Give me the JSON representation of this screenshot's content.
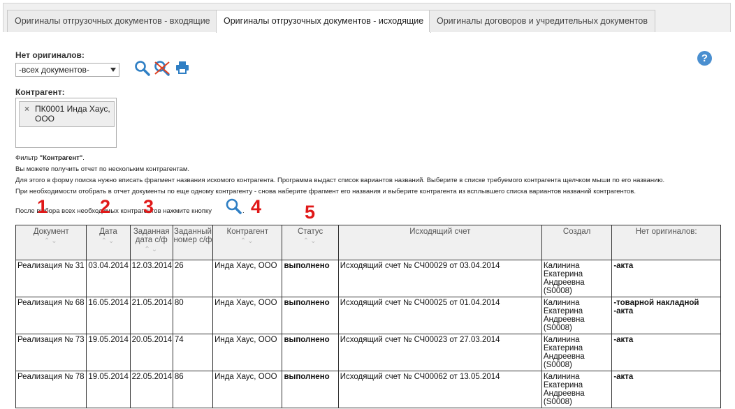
{
  "tabs": [
    {
      "label": "Оригиналы отгрузочных документов - входящие",
      "active": false
    },
    {
      "label": "Оригиналы отгрузочных документов - исходящие",
      "active": true
    },
    {
      "label": "Оригиналы договоров и учредительных документов",
      "active": false
    }
  ],
  "filter": {
    "no_originals_label": "Нет оригиналов:",
    "select_value": "-всех документов-",
    "counterparty_label": "Контрагент:",
    "chip": "ПК0001 Инда Хаус, ООО"
  },
  "help": "?",
  "notes": {
    "line1_prefix": "Фильтр ",
    "line1_bold": "\"Контрагент\"",
    "line1_suffix": ".",
    "line2": "Вы можете получить отчет по нескольким контрагентам.",
    "line3": "Для этого в форму поиска нужно вписать фрагмент названия искомого контрагента. Программа выдаст список вариантов названий. Выберите в списке требуемого контрагента щелчком мыши по его названию.",
    "line4": "При необходимости отобрать в отчет документы по еще одному контрагенту - снова наберите фрагмент его названия и выберите контрагента из всплывшего списка вариантов названий контрагентов.",
    "line5": "После выбора всех необходимых контрагентов нажмите кнопку",
    "line5_end": "."
  },
  "markers": [
    "1",
    "2",
    "3",
    "4",
    "5"
  ],
  "table": {
    "headers": [
      {
        "label": "Документ",
        "sort": "⌃⌄"
      },
      {
        "label": "Дата",
        "sort": "⌃⌄"
      },
      {
        "label": "Заданная дата с/ф",
        "sort": "⌃⌄"
      },
      {
        "label": "Заданный номер с/ф",
        "sort": ""
      },
      {
        "label": "Контрагент",
        "sort": "⌃⌄"
      },
      {
        "label": "Статус",
        "sort": "⌃⌄"
      },
      {
        "label": "Исходящий счет",
        "sort": ""
      },
      {
        "label": "Создал",
        "sort": ""
      },
      {
        "label": "Нет оригиналов:",
        "sort": ""
      }
    ],
    "rows": [
      {
        "doc": "Реализация № 31",
        "date": "03.04.2014",
        "sf_date": "12.03.2014",
        "sf_num": "26",
        "counterparty": "Инда Хаус, ООО",
        "status": "выполнено",
        "invoice": "Исходящий счет № СЧ00029 от 03.04.2014",
        "created": "Калинина Екатерина Андреевна (S0008)",
        "missing": "-акта"
      },
      {
        "doc": "Реализация № 68",
        "date": "16.05.2014",
        "sf_date": "21.05.2014",
        "sf_num": "80",
        "counterparty": "Инда Хаус, ООО",
        "status": "выполнено",
        "invoice": "Исходящий счет № СЧ00025 от 01.04.2014",
        "created": "Калинина Екатерина Андреевна (S0008)",
        "missing": "-товарной накладной\n-акта"
      },
      {
        "doc": "Реализация № 73",
        "date": "19.05.2014",
        "sf_date": "20.05.2014",
        "sf_num": "74",
        "counterparty": "Инда Хаус, ООО",
        "status": "выполнено",
        "invoice": "Исходящий счет № СЧ00023 от 27.03.2014",
        "created": "Калинина Екатерина Андреевна (S0008)",
        "missing": "-акта"
      },
      {
        "doc": "Реализация № 78",
        "date": "19.05.2014",
        "sf_date": "22.05.2014",
        "sf_num": "86",
        "counterparty": "Инда Хаус, ООО",
        "status": "выполнено",
        "invoice": "Исходящий счет № СЧ00062 от 13.05.2014",
        "created": "Калинина Екатерина Андреевна (S0008)",
        "missing": "-акта"
      }
    ]
  }
}
